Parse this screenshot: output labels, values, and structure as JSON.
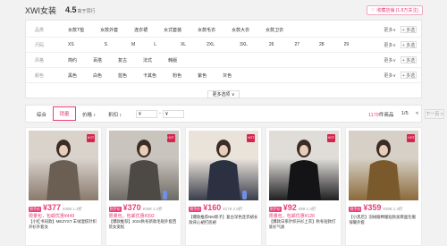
{
  "header": {
    "shop": "XWI女装",
    "score": "4.5",
    "score_sub": "高于同行",
    "fav_label": "收藏店铺 (1.8万关注)"
  },
  "filters": [
    {
      "label": "品类",
      "items": [
        "女款T恤",
        "女款外套",
        "连衣裙",
        "女式套装",
        "女款毛衣",
        "女款大衣",
        "女款卫衣"
      ],
      "more": "更多∨",
      "multi": "+ 多选"
    },
    {
      "label": "尺码",
      "items": [
        "XS",
        "S",
        "M",
        "L",
        "XL",
        "2XL",
        "3XL",
        "26",
        "27",
        "28",
        "29"
      ],
      "more": "更多∨",
      "multi": "+ 多选"
    },
    {
      "label": "风格",
      "items": [
        "简约",
        "百搭",
        "复古",
        "法式",
        "韩版"
      ],
      "more": "更多∨",
      "multi": "+ 多选"
    },
    {
      "label": "颜色",
      "items": [
        "黑色",
        "白色",
        "蓝色",
        "卡其色",
        "粉色",
        "紫色",
        "灰色"
      ],
      "more": "更多∨",
      "multi": "+ 多选"
    }
  ],
  "expand_label": "更多选项 ∨",
  "sort": {
    "items": [
      "综合",
      "销量",
      "价格 ↕",
      "折扣 ↕"
    ],
    "price_from": "¥",
    "price_to": "¥",
    "total_prefix": "1179",
    "total_suffix": "件商品",
    "page": "1/5",
    "prev": "<",
    "next": "下一页 >"
  },
  "products": [
    {
      "tag": "到手价",
      "price": "¥377",
      "old": "¥398 1.3折",
      "promo": "限量包，包邮优惠¥449",
      "title": "【小红书同款】MEZYST 羊绒混纺针织开衫外套女",
      "img_top": "#d9d3cc",
      "img_bottom": "#8a7a6d",
      "figure": "#6b5e52"
    },
    {
      "tag": "到手价",
      "price": "¥370",
      "old": "¥398 1.2折",
      "promo": "限量包，包邮优惠¥392",
      "title": "【爆款推荐】2024秋冬新款毛呢外套西装女宽松",
      "img_top": "#c9c4bd",
      "img_bottom": "#6e6a64",
      "figure": "#4d4a45"
    },
    {
      "tag": "到手价",
      "price": "¥160",
      "old": "¥178 2.5折",
      "promo": "",
      "title": "【爆款推荐NM新子】复古深色连衣裙长款背心裙打底裙",
      "img_top": "#e9e3da",
      "img_bottom": "#3a3d4a",
      "figure": "#2c3142"
    },
    {
      "tag": "到手价",
      "price": "¥92",
      "old": "¥98 1.3折",
      "promo": "限量包，包邮优惠¥128",
      "title": "【爆款日系针织开衫上衣】秋冬短款打底衫气质",
      "img_top": "#e0ddd8",
      "img_bottom": "#1f1f22",
      "figure": "#141416"
    },
    {
      "tag": "到手价",
      "price": "¥359",
      "old": "¥398 1.4折",
      "promo": "",
      "title": "【小黑店】羽绒服棉服短款加厚面包服保暖外套",
      "img_top": "#d6d0c6",
      "img_bottom": "#8c6a3a",
      "figure": "#7a5a2c"
    }
  ]
}
